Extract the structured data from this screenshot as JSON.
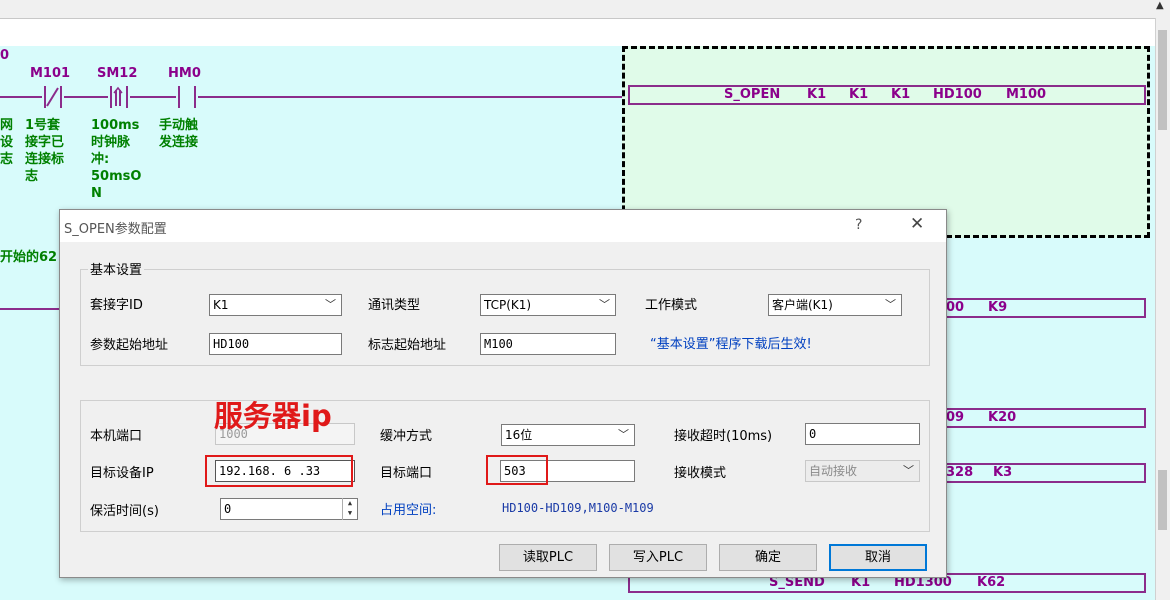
{
  "ladder": {
    "left_label": "0",
    "contacts": [
      {
        "label": "M101",
        "comment": [
          "1号套",
          "接字已",
          "连接标",
          "志"
        ]
      },
      {
        "label": "SM12",
        "comment": [
          "100ms",
          "时钟脉",
          "冲:",
          "50msO",
          "N"
        ]
      },
      {
        "label": "HM0",
        "comment": [
          "手动触",
          "发连接"
        ]
      }
    ],
    "left_comment": [
      "网",
      "设",
      "志"
    ],
    "left_bottom_comment": "开始的62",
    "instructions": [
      {
        "tokens": [
          "S_OPEN",
          "K1",
          "K1",
          "K1",
          "HD100",
          "M100"
        ]
      },
      {
        "tokens": [
          "00",
          "K9"
        ]
      },
      {
        "tokens": [
          "09",
          "K20"
        ]
      },
      {
        "tokens": [
          "328",
          "K3"
        ]
      },
      {
        "tokens": [
          "S_SEND",
          "K1",
          "HD1300",
          "K62"
        ]
      }
    ]
  },
  "dialog": {
    "title": "S_OPEN参数配置",
    "help": "?",
    "close": "✕",
    "basic_group_title": "基本设置",
    "socket_id_label": "套接字ID",
    "socket_id_value": "K1",
    "comm_type_label": "通讯类型",
    "comm_type_value": "TCP(K1)",
    "work_mode_label": "工作模式",
    "work_mode_value": "客户端(K1)",
    "param_addr_label": "参数起始地址",
    "param_addr_value": "HD100",
    "flag_addr_label": "标志起始地址",
    "flag_addr_value": "M100",
    "basic_note": "“基本设置”程序下载后生效!",
    "local_port_label": "本机端口",
    "local_port_value": "1000",
    "buffer_label": "缓冲方式",
    "buffer_value": "16位",
    "recv_timeout_label": "接收超时(10ms)",
    "recv_timeout_value": "0",
    "target_ip_label": "目标设备IP",
    "target_ip_value": "192.168. 6 .33",
    "target_port_label": "目标端口",
    "target_port_value": "503",
    "recv_mode_label": "接收模式",
    "recv_mode_value": "自动接收",
    "keepalive_label": "保活时间(s)",
    "keepalive_value": "0",
    "space_label": "占用空间:",
    "space_value": "HD100-HD109,M100-M109",
    "read_plc": "读取PLC",
    "write_plc": "写入PLC",
    "ok": "确定",
    "cancel": "取消"
  },
  "annotation": "服务器ip",
  "colors": {
    "canvas": "#d8fbfb",
    "rung": "#8b2c8b",
    "comment": "#008000",
    "annotation": "#e01919"
  }
}
